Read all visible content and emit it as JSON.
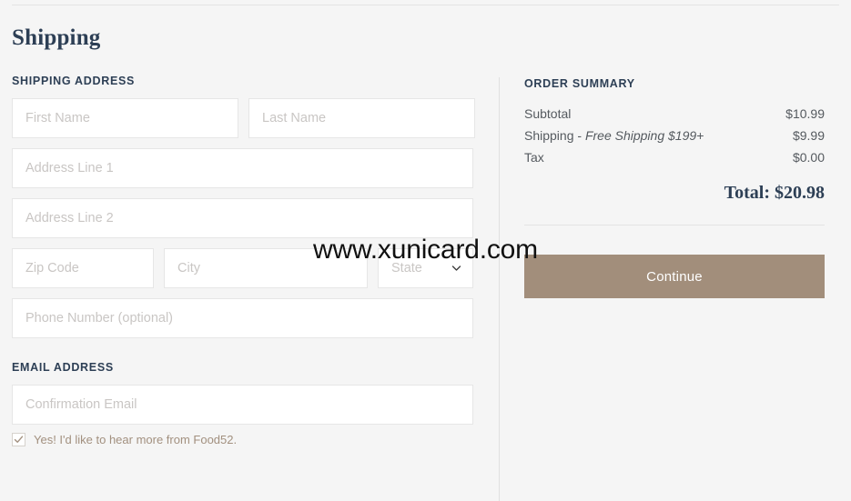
{
  "page": {
    "title": "Shipping",
    "watermark": "www.xunicard.com",
    "accent_color": "#a28e7b",
    "heading_color": "#2d3f55"
  },
  "shipping": {
    "section_label": "SHIPPING ADDRESS",
    "fields": {
      "first_name": {
        "placeholder": "First Name",
        "value": ""
      },
      "last_name": {
        "placeholder": "Last Name",
        "value": ""
      },
      "address_line_1": {
        "placeholder": "Address Line 1",
        "value": ""
      },
      "address_line_2": {
        "placeholder": "Address Line 2",
        "value": ""
      },
      "zip_code": {
        "placeholder": "Zip Code",
        "value": ""
      },
      "city": {
        "placeholder": "City",
        "value": ""
      },
      "state": {
        "placeholder": "State",
        "value": "",
        "icon": "chevron-down-icon"
      },
      "phone": {
        "placeholder": "Phone Number (optional)",
        "value": ""
      }
    }
  },
  "email": {
    "section_label": "EMAIL ADDRESS",
    "confirmation_email": {
      "placeholder": "Confirmation Email",
      "value": ""
    },
    "newsletter_optin": {
      "label": "Yes! I'd like to hear more from Food52.",
      "checked": true,
      "check_color": "#a2907f"
    }
  },
  "order_summary": {
    "label": "ORDER SUMMARY",
    "lines": [
      {
        "label": "Subtotal",
        "note": "",
        "amount": "$10.99"
      },
      {
        "label": "Shipping - ",
        "note": "Free Shipping $199+",
        "amount": "$9.99"
      },
      {
        "label": "Tax",
        "note": "",
        "amount": "$0.00"
      }
    ],
    "total": "Total: $20.98",
    "continue_label": "Continue"
  }
}
